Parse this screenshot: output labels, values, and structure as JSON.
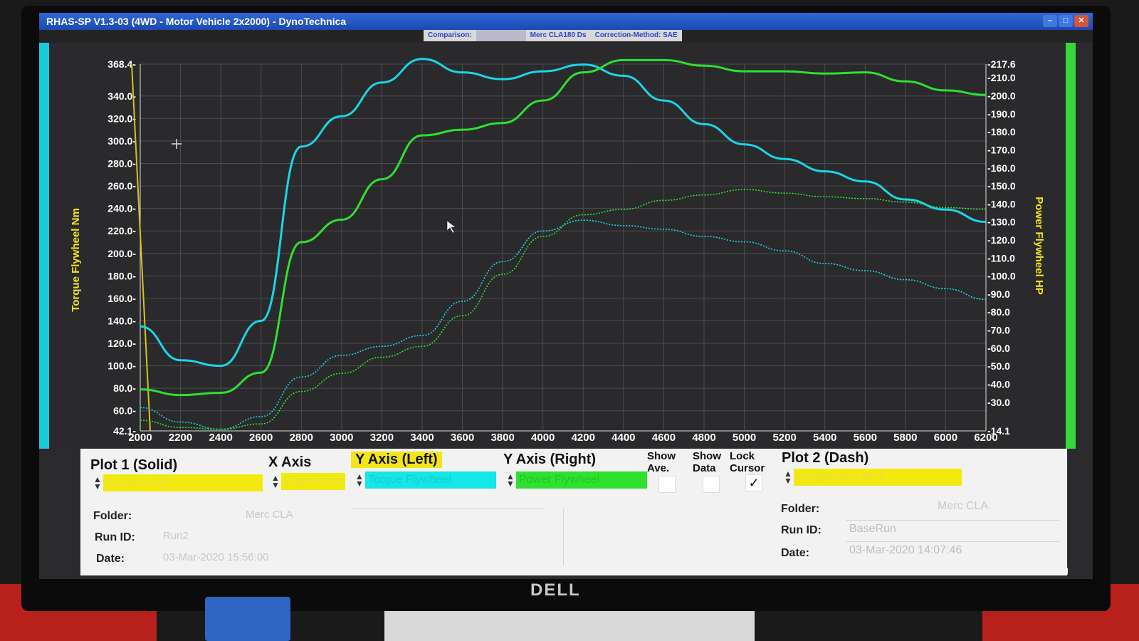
{
  "window": {
    "title": "RHAS-SP V1.3-03  (4WD - Motor Vehicle 2x2000) - DynoTechnica",
    "comparison_label": "Comparison:",
    "vehicle_label": "Merc CLA180 Ds",
    "correction_label": "Correction-Method: SAE"
  },
  "chart_data": {
    "type": "line",
    "xlabel": "",
    "ylabel_left": "Torque Flywheel Nm",
    "ylabel_right": "Power Flywheel HP",
    "xlim": [
      2000,
      6200
    ],
    "ylim_left": [
      42.1,
      368.4
    ],
    "ylim_right": [
      14.1,
      217.6
    ],
    "x_ticks": [
      "2000",
      "2200",
      "2400",
      "2600",
      "2800",
      "3000",
      "3200",
      "3400",
      "3600",
      "3800",
      "4000",
      "4200",
      "4400",
      "4600",
      "4800",
      "5000",
      "5200",
      "5400",
      "5600",
      "5800",
      "6000",
      "6200"
    ],
    "y_left_ticks": [
      "368.4-",
      "340.0-",
      "320.0-",
      "300.0-",
      "280.0-",
      "260.0-",
      "240.0-",
      "220.0-",
      "200.0-",
      "180.0-",
      "160.0-",
      "140.0-",
      "120.0-",
      "100.0-",
      "80.0-",
      "60.0-",
      "42.1-"
    ],
    "y_right_ticks": [
      "-217.6",
      "-210.0",
      "-200.0",
      "-190.0",
      "-180.0",
      "-170.0",
      "-160.0",
      "-150.0",
      "-140.0",
      "-130.0",
      "-120.0",
      "-110.0",
      "-100.0",
      "-90.0",
      "-80.0",
      "-70.0",
      "-60.0",
      "-50.0",
      "-40.0",
      "-30.0",
      "-14.1"
    ],
    "series": [
      {
        "axis": "left",
        "style": "solid",
        "color": "#1ad6e6",
        "x": [
          2000,
          2200,
          2400,
          2600,
          2800,
          3000,
          3200,
          3400,
          3600,
          3800,
          4000,
          4200,
          4400,
          4600,
          4800,
          5000,
          5200,
          5400,
          5600,
          5800,
          6000,
          6200
        ],
        "y": [
          135,
          105,
          100,
          140,
          295,
          322,
          352,
          373,
          361,
          355,
          362,
          368,
          358,
          336,
          315,
          297,
          284,
          273,
          264,
          248,
          239,
          228
        ]
      },
      {
        "axis": "left",
        "style": "solid",
        "color": "#2fe030",
        "x": [
          2000,
          2200,
          2400,
          2600,
          2800,
          3000,
          3200,
          3400,
          3600,
          3800,
          4000,
          4200,
          4400,
          4600,
          4800,
          5000,
          5200,
          5400,
          5600,
          5800,
          6000,
          6200
        ],
        "y": [
          79,
          74,
          76,
          94,
          210,
          230,
          266,
          305,
          310,
          316,
          336,
          361,
          372,
          372,
          367,
          362,
          362,
          360,
          361,
          353,
          345,
          341
        ]
      },
      {
        "axis": "right",
        "style": "dash",
        "color": "#1ad6e6",
        "x": [
          2000,
          2200,
          2400,
          2600,
          2800,
          3000,
          3200,
          3400,
          3600,
          3800,
          4000,
          4200,
          4400,
          4600,
          4800,
          5000,
          5200,
          5400,
          5600,
          5800,
          6000,
          6200
        ],
        "y": [
          27,
          19,
          15,
          22,
          44,
          56,
          61,
          67,
          86,
          108,
          125,
          131,
          128,
          126,
          122,
          119,
          114,
          107,
          103,
          98,
          93,
          87
        ]
      },
      {
        "axis": "right",
        "style": "dash",
        "color": "#2fe030",
        "x": [
          2000,
          2200,
          2400,
          2600,
          2800,
          3000,
          3200,
          3400,
          3600,
          3800,
          4000,
          4200,
          4400,
          4600,
          4800,
          5000,
          5200,
          5400,
          5600,
          5800,
          6000,
          6200
        ],
        "y": [
          20,
          16,
          15,
          18,
          36,
          46,
          55,
          61,
          78,
          101,
          122,
          134,
          137,
          142,
          145,
          148,
          146,
          144,
          143,
          141,
          138,
          137
        ]
      }
    ],
    "grid": true
  },
  "panel": {
    "plot1_header": "Plot 1 (Solid)",
    "x_axis_header": "X Axis",
    "y_left_header": "Y Axis (Left)",
    "y_right_header": "Y Axis (Right)",
    "show_ave": "Show Ave.",
    "show_data": "Show Data",
    "lock_cursor": "Lock Cursor",
    "plot2_header": "Plot 2 (Dash)",
    "plot1_select": "Autotune AP",
    "x_axis_select": "Engine rpm",
    "y_left_select": "Torque Flywheel",
    "y_right_select": "Power Flywheel",
    "plot2_select": "Comparison AP 2",
    "folder_label": "Folder:",
    "runid_label": "Run ID:",
    "date_label": "Date:",
    "plot1_folder": "Merc CLA",
    "plot1_runid": "Run2",
    "plot1_date": "03-Mar-2020  15:56:00",
    "plot2_folder": "Merc CLA",
    "plot2_runid": "BaseRun",
    "plot2_date": "03-Mar-2020  14:07:46",
    "lock_checked": "✓"
  },
  "monitor": {
    "brand": "DELL"
  }
}
